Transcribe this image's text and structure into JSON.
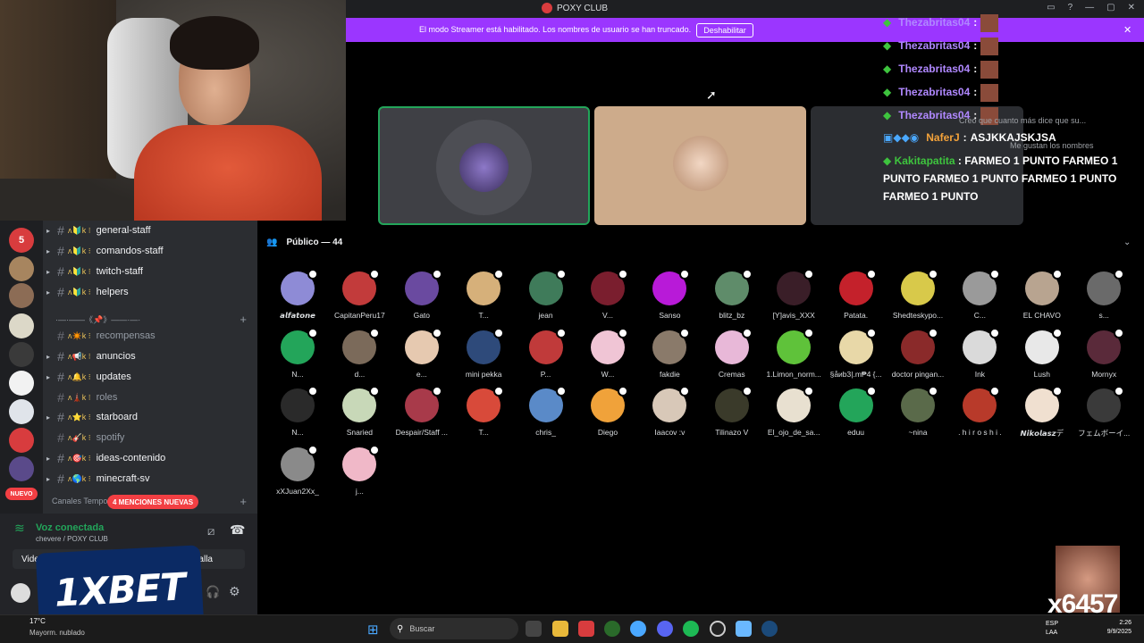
{
  "window": {
    "title": "POXY CLUB"
  },
  "streamer_bar": {
    "text": "El modo Streamer está habilitado. Los nombres de usuario se han truncado.",
    "button": "Deshabilitar"
  },
  "sidebar": {
    "channels": [
      {
        "name": "general-staff",
        "prefix": "ᴧ🔰k ⁝",
        "muted": false,
        "arrow": true
      },
      {
        "name": "comandos-staff",
        "prefix": "ᴧ🔰k ⁝",
        "muted": false,
        "arrow": true
      },
      {
        "name": "twitch-staff",
        "prefix": "ᴧ🔰k ⁝",
        "muted": false,
        "arrow": true
      },
      {
        "name": "helpers",
        "prefix": "ᴧ🔰k ⁝",
        "muted": false,
        "arrow": true
      },
      {
        "name": "recompensas",
        "prefix": "ᴧ✴️k ⁝",
        "muted": true,
        "arrow": false
      },
      {
        "name": "anuncios",
        "prefix": "ᴧ📢k ⁝",
        "muted": false,
        "arrow": true
      },
      {
        "name": "updates",
        "prefix": "ᴧ🔔k ⁝",
        "muted": false,
        "arrow": true
      },
      {
        "name": "roles",
        "prefix": "ᴧ🗼k ⁝",
        "muted": true,
        "arrow": false
      },
      {
        "name": "starboard",
        "prefix": "ᴧ⭐k ⁝",
        "muted": false,
        "arrow": true
      },
      {
        "name": "spotify",
        "prefix": "ᴧ🎸k ⁝",
        "muted": true,
        "arrow": false
      },
      {
        "name": "ideas-contenido",
        "prefix": "ᴧ🎯k ⁝",
        "muted": false,
        "arrow": true
      },
      {
        "name": "minecraft-sv",
        "prefix": "ᴧ🌎k ⁝",
        "muted": false,
        "arrow": true
      }
    ],
    "category_label": "·—·——《📌》——·—·",
    "temp_category": "Canales Tempo",
    "mentions_badge": "4 MENCIONES NUEVAS",
    "nuevo_badge": "NUEVO",
    "server_badge": "5"
  },
  "voice": {
    "status": "Voz conectada",
    "channel": "chevere / POXY CLUB",
    "video_btn": "Video",
    "screen_btn": "alla"
  },
  "ad": {
    "text": "1XBET"
  },
  "audience": {
    "title": "Público — 44",
    "members": [
      {
        "name": "𝙖𝙡𝙛𝙖𝙩𝙤𝙣𝙚",
        "color": "#8e8bd6"
      },
      {
        "name": "CapitanPeru17",
        "color": "#c23b3b"
      },
      {
        "name": "Gato",
        "color": "#6a4aa0"
      },
      {
        "name": "T...",
        "color": "#d6b07a"
      },
      {
        "name": "jean",
        "color": "#3f7b5a"
      },
      {
        "name": "V...",
        "color": "#7a1e2e"
      },
      {
        "name": "Sanso",
        "color": "#b81ad8"
      },
      {
        "name": "blitz_bz",
        "color": "#5f8c6a"
      },
      {
        "name": "[Y]avis_XXX",
        "color": "#3a1e28"
      },
      {
        "name": "Patata.",
        "color": "#c4212b"
      },
      {
        "name": "Shedteskypo...",
        "color": "#d8c94a"
      },
      {
        "name": "C...",
        "color": "#9a9a9a"
      },
      {
        "name": "EL CHAVO",
        "color": "#b8a490"
      },
      {
        "name": "s...",
        "color": "#6a6a6a"
      },
      {
        "name": "N...",
        "color": "#23a55a"
      },
      {
        "name": "d...",
        "color": "#7b6a5a"
      },
      {
        "name": "e...",
        "color": "#e6c9b0"
      },
      {
        "name": "mini pekka",
        "color": "#2e4a7a"
      },
      {
        "name": "P...",
        "color": "#c03a3a"
      },
      {
        "name": "W...",
        "color": "#f0c5d5"
      },
      {
        "name": "fakdie",
        "color": "#8a7a6a"
      },
      {
        "name": "Cremas",
        "color": "#e8b8d8"
      },
      {
        "name": "1.Limon_norm...",
        "color": "#5fc23a"
      },
      {
        "name": "§åиb3|.m₱4 {...",
        "color": "#e8d8a8"
      },
      {
        "name": "doctor pingan...",
        "color": "#8a2a2a"
      },
      {
        "name": "Ink",
        "color": "#dadada"
      },
      {
        "name": "Lush",
        "color": "#e8e8e8"
      },
      {
        "name": "Mornyx",
        "color": "#5a2a3a"
      },
      {
        "name": "N...",
        "color": "#2a2a2a"
      },
      {
        "name": "Snaried",
        "color": "#c8d8b8"
      },
      {
        "name": "Despair/Staff ...",
        "color": "#a83a4a"
      },
      {
        "name": "T...",
        "color": "#d84a3a"
      },
      {
        "name": "chris_",
        "color": "#5a8ac8"
      },
      {
        "name": "Diego",
        "color": "#f0a23a"
      },
      {
        "name": "Iaacov :v",
        "color": "#d8c8b8"
      },
      {
        "name": "Tilinazo V",
        "color": "#3a3a2a"
      },
      {
        "name": "El_ojo_de_sa...",
        "color": "#e8e0d0"
      },
      {
        "name": "eduu",
        "color": "#23a55a"
      },
      {
        "name": "~nina",
        "color": "#5a6a4a"
      },
      {
        "name": ". h i r o s h i .",
        "color": "#b83a2a"
      },
      {
        "name": "𝙉𝙞𝙠𝙤𝙡𝙖𝙨𝙯デ",
        "color": "#f0e0d0"
      },
      {
        "name": "フェムボーイ...",
        "color": "#3a3a3a"
      },
      {
        "name": "xXJuan2Xx_",
        "color": "#8a8a8a"
      },
      {
        "name": "j...",
        "color": "#f0b8c8"
      }
    ]
  },
  "chat": {
    "lines": [
      {
        "user": "Thezabritas04",
        "kind": "thez"
      },
      {
        "user": "Thezabritas04",
        "kind": "thez"
      },
      {
        "user": "Thezabritas04",
        "kind": "thez"
      },
      {
        "user": "Thezabritas04",
        "kind": "thez"
      },
      {
        "user": "Thezabritas04",
        "kind": "thez"
      }
    ],
    "naferj_user": "NaferJ",
    "naferj_msg": "ASJKKAJSKJSA",
    "kakita_user": "Kakitapatita",
    "kakita_msg": "FARMEO 1 PUNTO FARMEO 1 PUNTO FARMEO 1 PUNTO FARMEO 1 PUNTO FARMEO 1 PUNTO",
    "bg_text_1": "Creo que cuanto más dice que su...",
    "bg_text_2": "Me gustan los nombres"
  },
  "emote": {
    "text": "x6457"
  },
  "taskbar": {
    "weather_temp": "17°C",
    "weather_desc": "Mayorm. nublado",
    "search_placeholder": "Buscar",
    "lang": "ESP\nLAA",
    "time": "2:26",
    "date": "9/9/2025"
  }
}
